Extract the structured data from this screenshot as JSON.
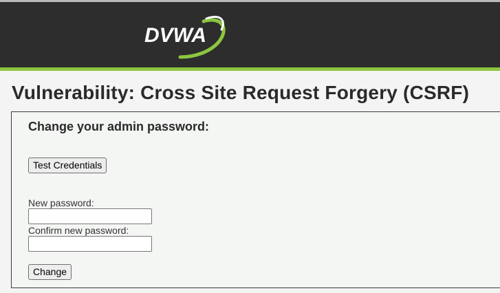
{
  "header": {
    "logo_text": "DVWA",
    "background_color": "#2d2d2d",
    "accent_color": "#8cc63f"
  },
  "page": {
    "title": "Vulnerability: Cross Site Request Forgery (CSRF)"
  },
  "form": {
    "heading": "Change your admin password:",
    "test_credentials_label": "Test Credentials",
    "new_password_label": "New password:",
    "new_password_value": "",
    "confirm_password_label": "Confirm new password:",
    "confirm_password_value": "",
    "change_label": "Change"
  }
}
